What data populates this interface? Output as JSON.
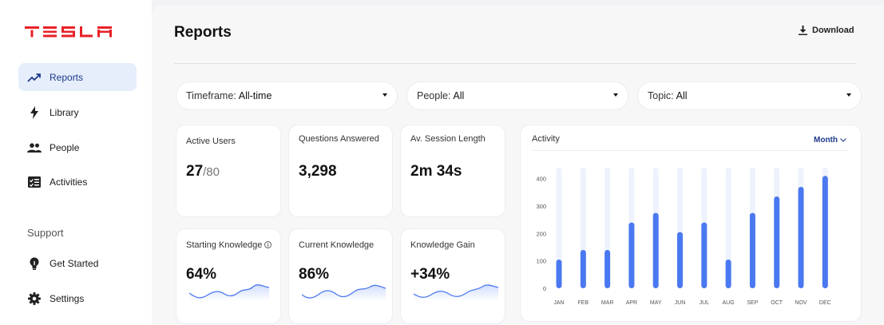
{
  "brand": {
    "logo_text": "TESLA",
    "color": "#e82127"
  },
  "sidebar": {
    "items": [
      {
        "label": "Reports",
        "icon": "trending-up-icon",
        "active": true
      },
      {
        "label": "Library",
        "icon": "bolt-icon",
        "active": false
      },
      {
        "label": "People",
        "icon": "people-icon",
        "active": false
      },
      {
        "label": "Activities",
        "icon": "activity-list-icon",
        "active": false
      }
    ],
    "support_label": "Support",
    "support_items": [
      {
        "label": "Get Started",
        "icon": "lightbulb-icon"
      },
      {
        "label": "Settings",
        "icon": "gear-icon"
      }
    ]
  },
  "header": {
    "title": "Reports",
    "download_label": "Download"
  },
  "filters": [
    {
      "key": "Timeframe:",
      "value": "All-time"
    },
    {
      "key": "People:",
      "value": "All"
    },
    {
      "key": "Topic:",
      "value": "All"
    }
  ],
  "stats": [
    {
      "label": "Active Users",
      "value": "27",
      "suffix": "/80"
    },
    {
      "label": "Questions Answered",
      "value": "3,298"
    },
    {
      "label": "Av. Session Length",
      "value": "2m 34s"
    },
    {
      "label": "Starting Knowledge",
      "value": "64%",
      "info": true
    },
    {
      "label": "Current Knowledge",
      "value": "86%"
    },
    {
      "label": "Knowledge Gain",
      "value": "+34%"
    }
  ],
  "activity": {
    "title": "Activity",
    "range_label": "Month"
  },
  "chart_data": {
    "type": "bar",
    "title": "Activity",
    "categories": [
      "JAN",
      "FEB",
      "MAR",
      "APR",
      "MAY",
      "JUN",
      "JUL",
      "AUG",
      "SEP",
      "OCT",
      "NOV",
      "DEC"
    ],
    "values": [
      105,
      140,
      140,
      240,
      275,
      205,
      240,
      105,
      275,
      335,
      370,
      410
    ],
    "yticks": [
      0,
      100,
      200,
      300,
      400
    ],
    "ylim": [
      0,
      440
    ],
    "grid": false,
    "bar_color": "#4a78f0",
    "track_color": "#eef2fc"
  },
  "colors": {
    "accent": "#4a78f0",
    "active_bg": "#e6eefc",
    "range": "#1e3a8a"
  }
}
